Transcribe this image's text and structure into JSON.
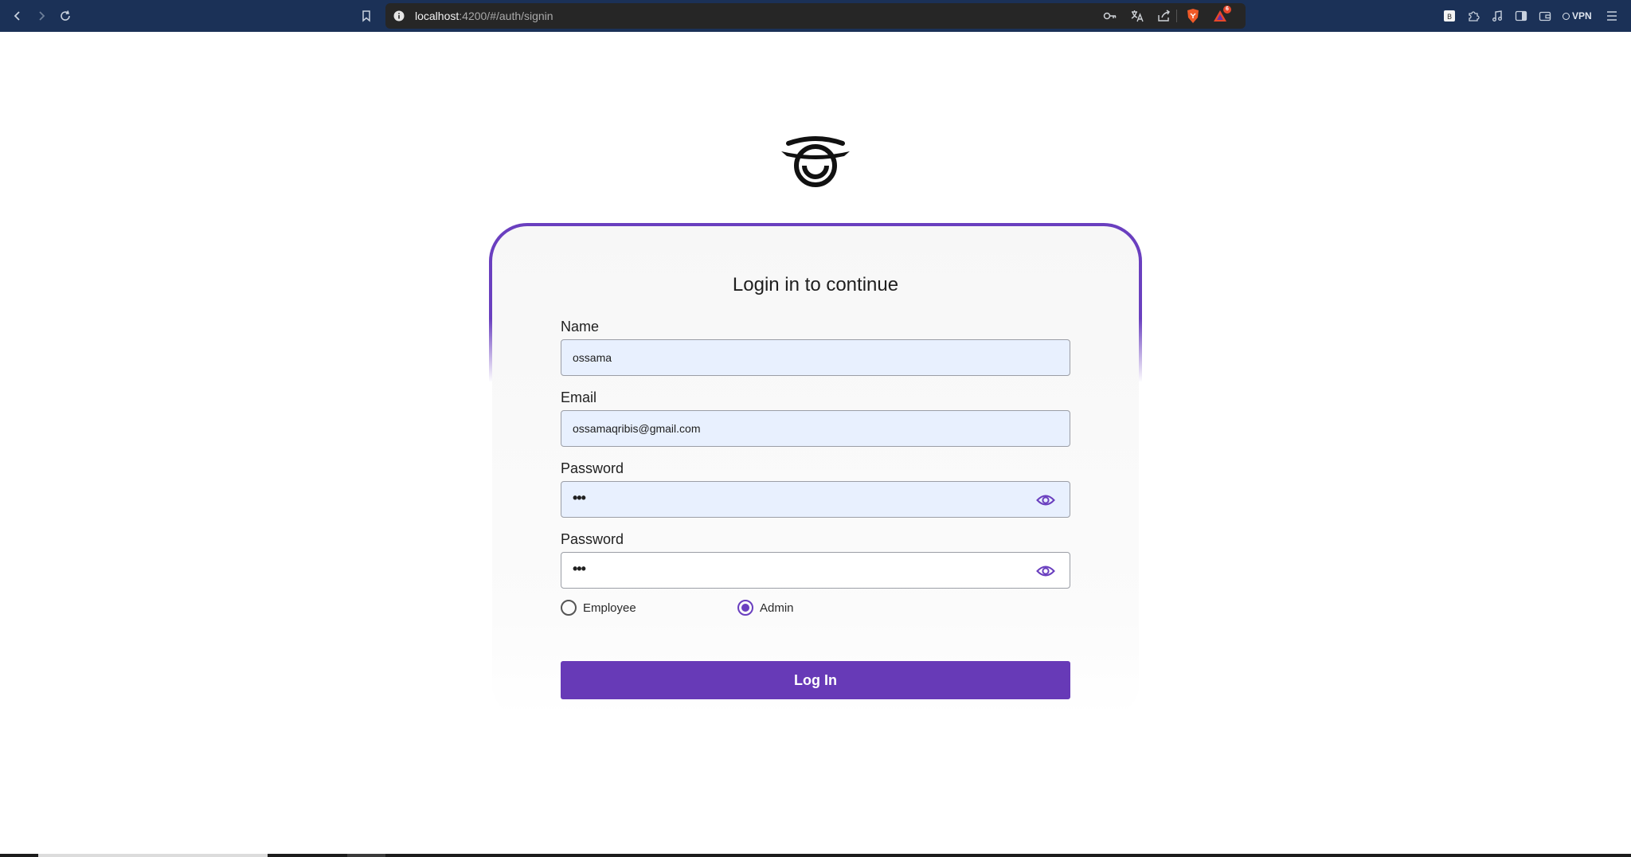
{
  "browser": {
    "url_host": "localhost",
    "url_path": ":4200/#/auth/signin",
    "vpn_label": "VPN",
    "shield_badge": "6",
    "icons": [
      "back-icon",
      "forward-icon",
      "reload-icon",
      "bookmark-icon",
      "site-info-icon",
      "key-icon",
      "translate-icon",
      "share-icon",
      "brave-shield-icon",
      "brave-rewards-icon",
      "extension-icon",
      "puzzle-icon",
      "music-icon",
      "sidebar-icon",
      "wallet-icon",
      "menu-icon"
    ]
  },
  "colors": {
    "accent": "#673ab7",
    "toolbar": "#1b3157",
    "field_autofill": "#e8f0fe"
  },
  "form": {
    "title": "Login in to continue",
    "name_label": "Name",
    "name_value": "ossama",
    "email_label": "Email",
    "email_value": "ossamaqribis@gmail.com",
    "password_label": "Password",
    "password_value": "•••",
    "confirm_label": "Password",
    "confirm_value": "•••",
    "role_options": [
      {
        "label": "Employee",
        "selected": false
      },
      {
        "label": "Admin",
        "selected": true
      }
    ],
    "submit_label": "Log In"
  }
}
